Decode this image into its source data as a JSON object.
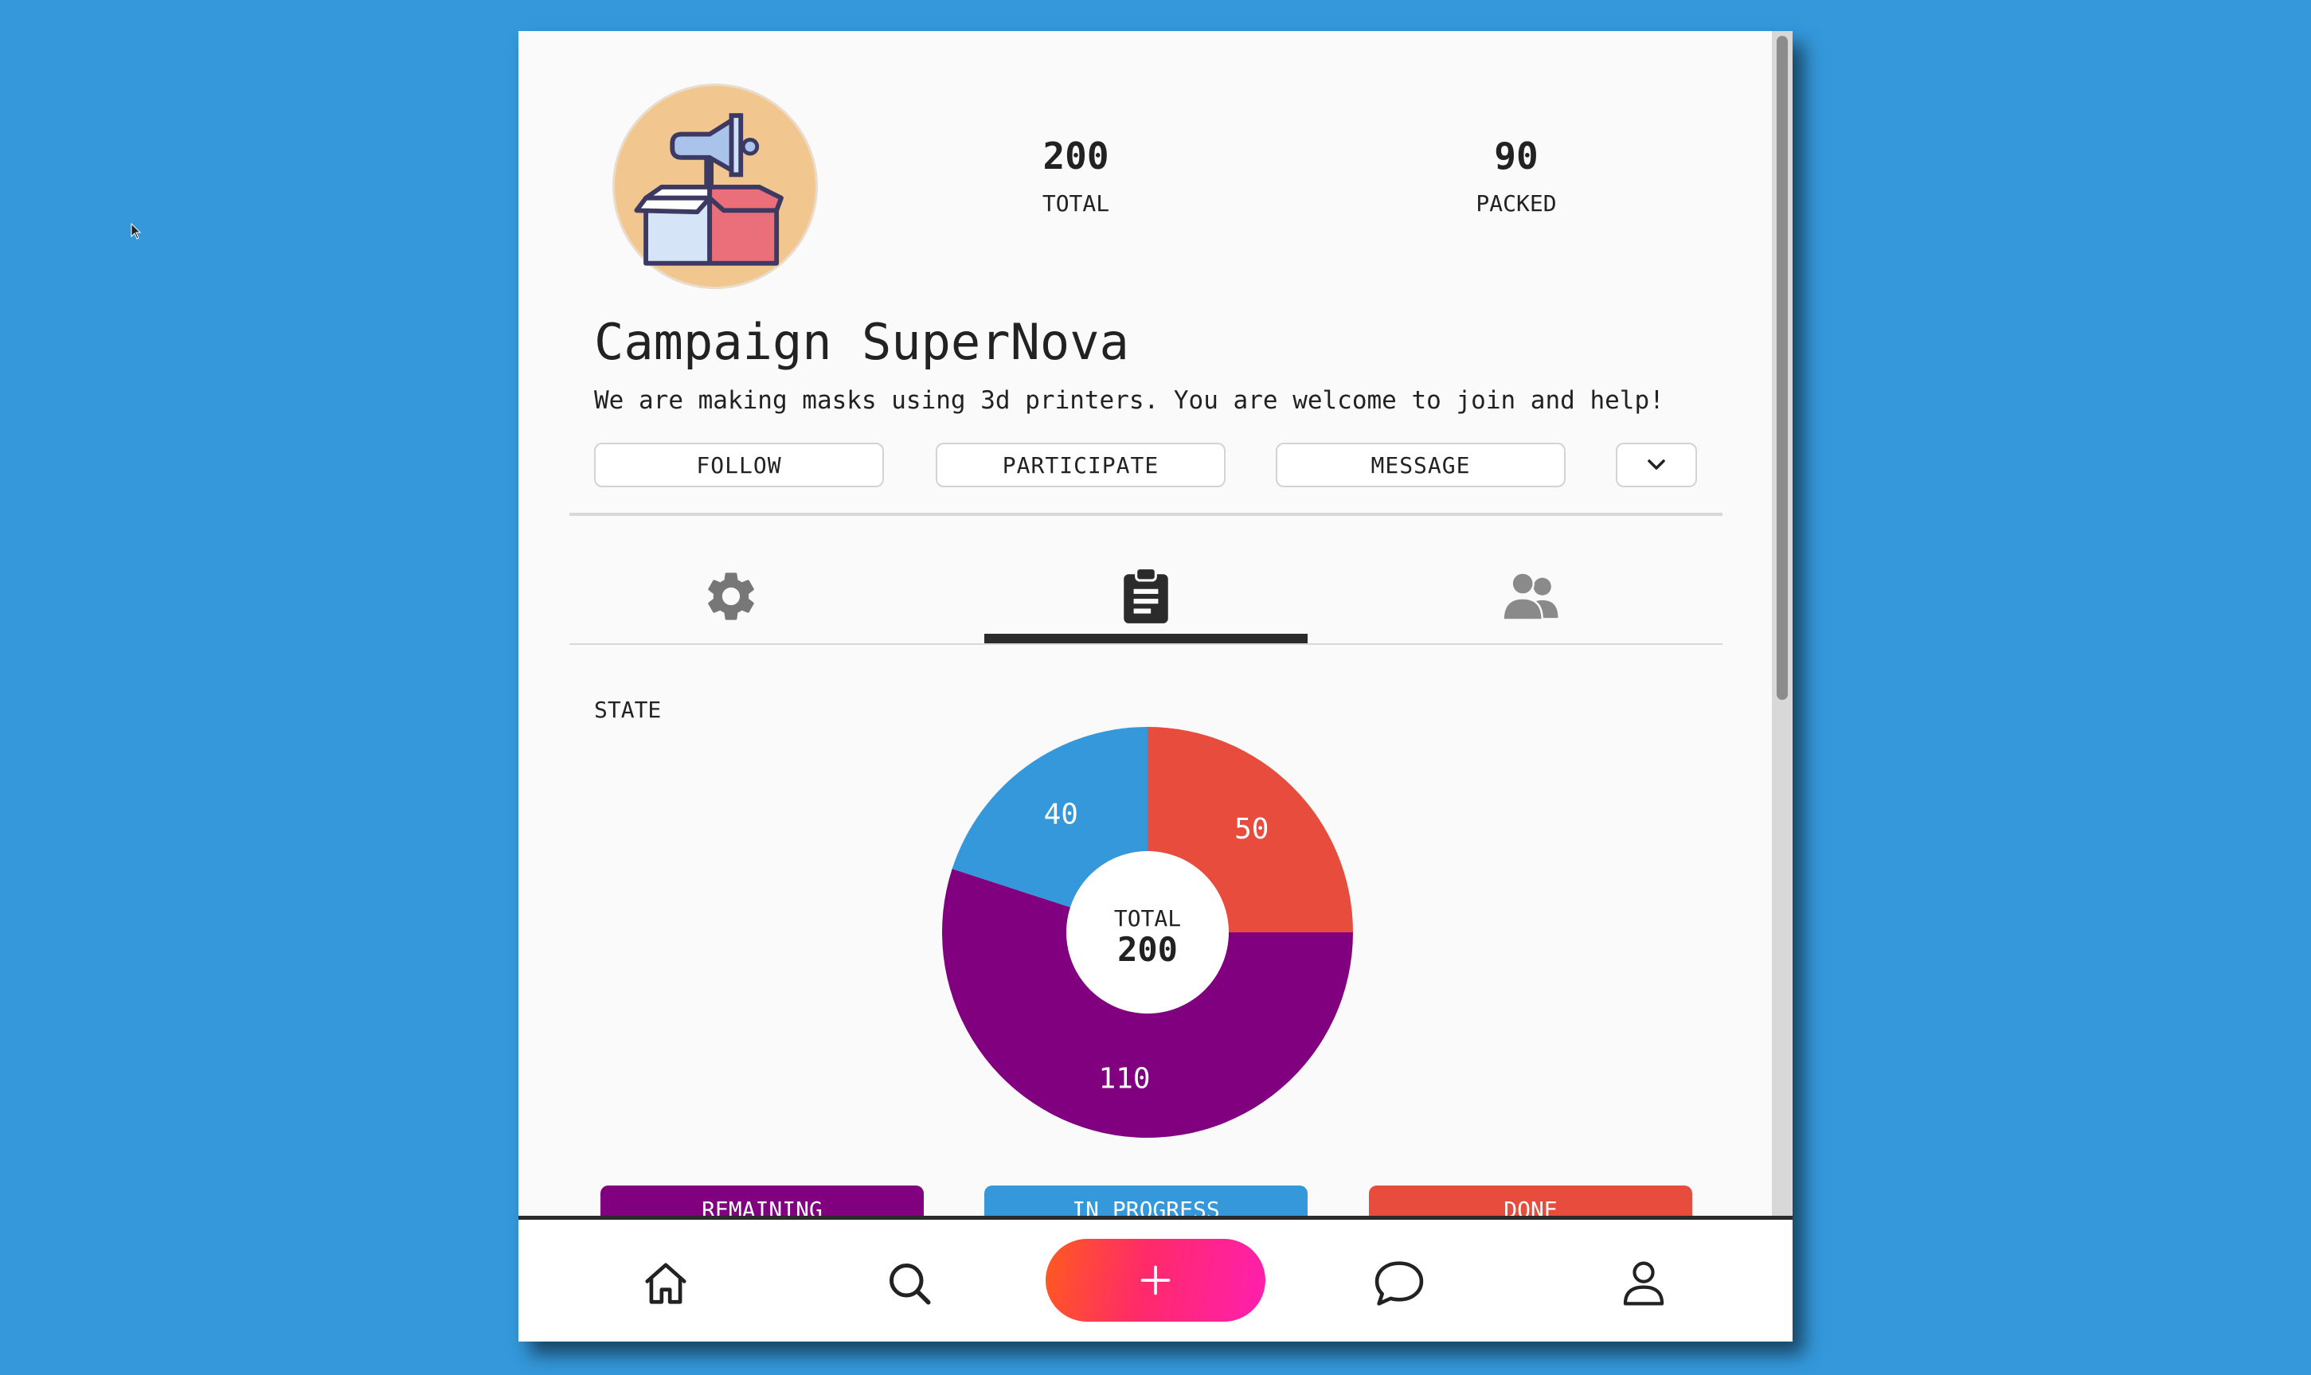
{
  "campaign": {
    "title": "Campaign SuperNova",
    "description": "We are making masks using 3d printers. You are welcome to join and help!",
    "avatar_icon": "megaphone-box-icon"
  },
  "stats": {
    "total_value": "200",
    "total_label": "TOTAL",
    "packed_value": "90",
    "packed_label": "PACKED"
  },
  "actions": {
    "follow": "FOLLOW",
    "participate": "PARTICIPATE",
    "message": "MESSAGE",
    "more_icon": "chevron-down-icon"
  },
  "tabs": [
    {
      "icon": "gear-icon",
      "active": false
    },
    {
      "icon": "clipboard-icon",
      "active": true
    },
    {
      "icon": "users-icon",
      "active": false
    }
  ],
  "state": {
    "label": "STATE",
    "center_label": "TOTAL",
    "center_value": "200",
    "legend": {
      "remaining": "REMAINING",
      "in_progress": "IN PROGRESS",
      "done": "DONE"
    }
  },
  "chart_data": {
    "type": "pie",
    "donut": true,
    "center_text": "TOTAL",
    "center_value": 200,
    "series": [
      {
        "name": "DONE",
        "value": 50,
        "color": "#e74c3c"
      },
      {
        "name": "REMAINING",
        "value": 110,
        "color": "#800080"
      },
      {
        "name": "IN PROGRESS",
        "value": 40,
        "color": "#3498db"
      }
    ]
  },
  "bottom_nav": {
    "items": [
      "home-icon",
      "search-icon",
      "plus-icon",
      "chat-icon",
      "profile-icon"
    ]
  },
  "colors": {
    "background": "#3498db",
    "remaining": "#800080",
    "in_progress": "#3498db",
    "done": "#e74c3c",
    "avatar_bg": "#f2c78f"
  }
}
